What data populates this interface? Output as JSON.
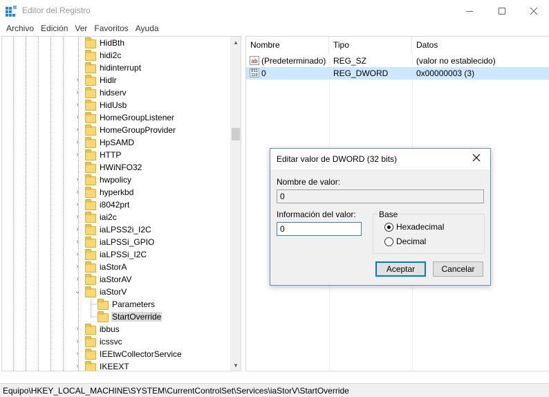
{
  "window": {
    "title": "Editor del Registro",
    "icon": "registry-icon"
  },
  "menu": [
    "Archivo",
    "Edición",
    "Ver",
    "Favoritos",
    "Ayuda"
  ],
  "tree": {
    "items": [
      {
        "label": "HidBth",
        "expandable": false,
        "level": 0
      },
      {
        "label": "hidi2c",
        "expandable": false,
        "level": 0
      },
      {
        "label": "hidinterrupt",
        "expandable": false,
        "level": 0
      },
      {
        "label": "Hidlr",
        "expandable": true,
        "level": 0
      },
      {
        "label": "hidserv",
        "expandable": true,
        "level": 0
      },
      {
        "label": "HidUsb",
        "expandable": true,
        "level": 0
      },
      {
        "label": "HomeGroupListener",
        "expandable": true,
        "level": 0
      },
      {
        "label": "HomeGroupProvider",
        "expandable": true,
        "level": 0
      },
      {
        "label": "HpSAMD",
        "expandable": true,
        "level": 0
      },
      {
        "label": "HTTP",
        "expandable": true,
        "level": 0
      },
      {
        "label": "HWiNFO32",
        "expandable": false,
        "level": 0
      },
      {
        "label": "hwpolicy",
        "expandable": true,
        "level": 0
      },
      {
        "label": "hyperkbd",
        "expandable": true,
        "level": 0
      },
      {
        "label": "i8042prt",
        "expandable": true,
        "level": 0
      },
      {
        "label": "iai2c",
        "expandable": true,
        "level": 0
      },
      {
        "label": "iaLPSS2i_I2C",
        "expandable": true,
        "level": 0
      },
      {
        "label": "iaLPSSi_GPIO",
        "expandable": true,
        "level": 0
      },
      {
        "label": "iaLPSSi_I2C",
        "expandable": true,
        "level": 0
      },
      {
        "label": "iaStorA",
        "expandable": true,
        "level": 0
      },
      {
        "label": "iaStorAV",
        "expandable": true,
        "level": 0
      },
      {
        "label": "iaStorV",
        "expandable": true,
        "expanded": true,
        "level": 0
      },
      {
        "label": "Parameters",
        "expandable": false,
        "level": 1
      },
      {
        "label": "StartOverride",
        "expandable": false,
        "level": 1,
        "selected": true
      },
      {
        "label": "ibbus",
        "expandable": true,
        "level": 0
      },
      {
        "label": "icssvc",
        "expandable": true,
        "level": 0
      },
      {
        "label": "IEEtwCollectorService",
        "expandable": true,
        "level": 0
      },
      {
        "label": "IKEEXT",
        "expandable": true,
        "level": 0
      }
    ]
  },
  "list": {
    "columns": [
      "Nombre",
      "Tipo",
      "Datos"
    ],
    "rows": [
      {
        "icon": "string-value-icon",
        "icon_text": "ab",
        "name": "(Predeterminado)",
        "type": "REG_SZ",
        "data": "(valor no establecido)",
        "selected": false
      },
      {
        "icon": "binary-value-icon",
        "icon_text": "011\n110",
        "name": "0",
        "type": "REG_DWORD",
        "data": "0x00000003 (3)",
        "selected": true
      }
    ]
  },
  "status": {
    "path": "Equipo\\HKEY_LOCAL_MACHINE\\SYSTEM\\CurrentControlSet\\Services\\iaStorV\\StartOverride"
  },
  "dialog": {
    "title": "Editar valor de DWORD (32 bits)",
    "value_name_label": "Nombre de valor:",
    "value_name": "0",
    "value_data_label": "Información del valor:",
    "value_data": "0",
    "base_label": "Base",
    "base_options": [
      {
        "label": "Hexadecimal",
        "checked": true
      },
      {
        "label": "Decimal",
        "checked": false
      }
    ],
    "ok_label": "Aceptar",
    "cancel_label": "Cancelar"
  },
  "colors": {
    "selection": "#cce8ff",
    "accent": "#0078d7",
    "folder": "#f8d775"
  }
}
